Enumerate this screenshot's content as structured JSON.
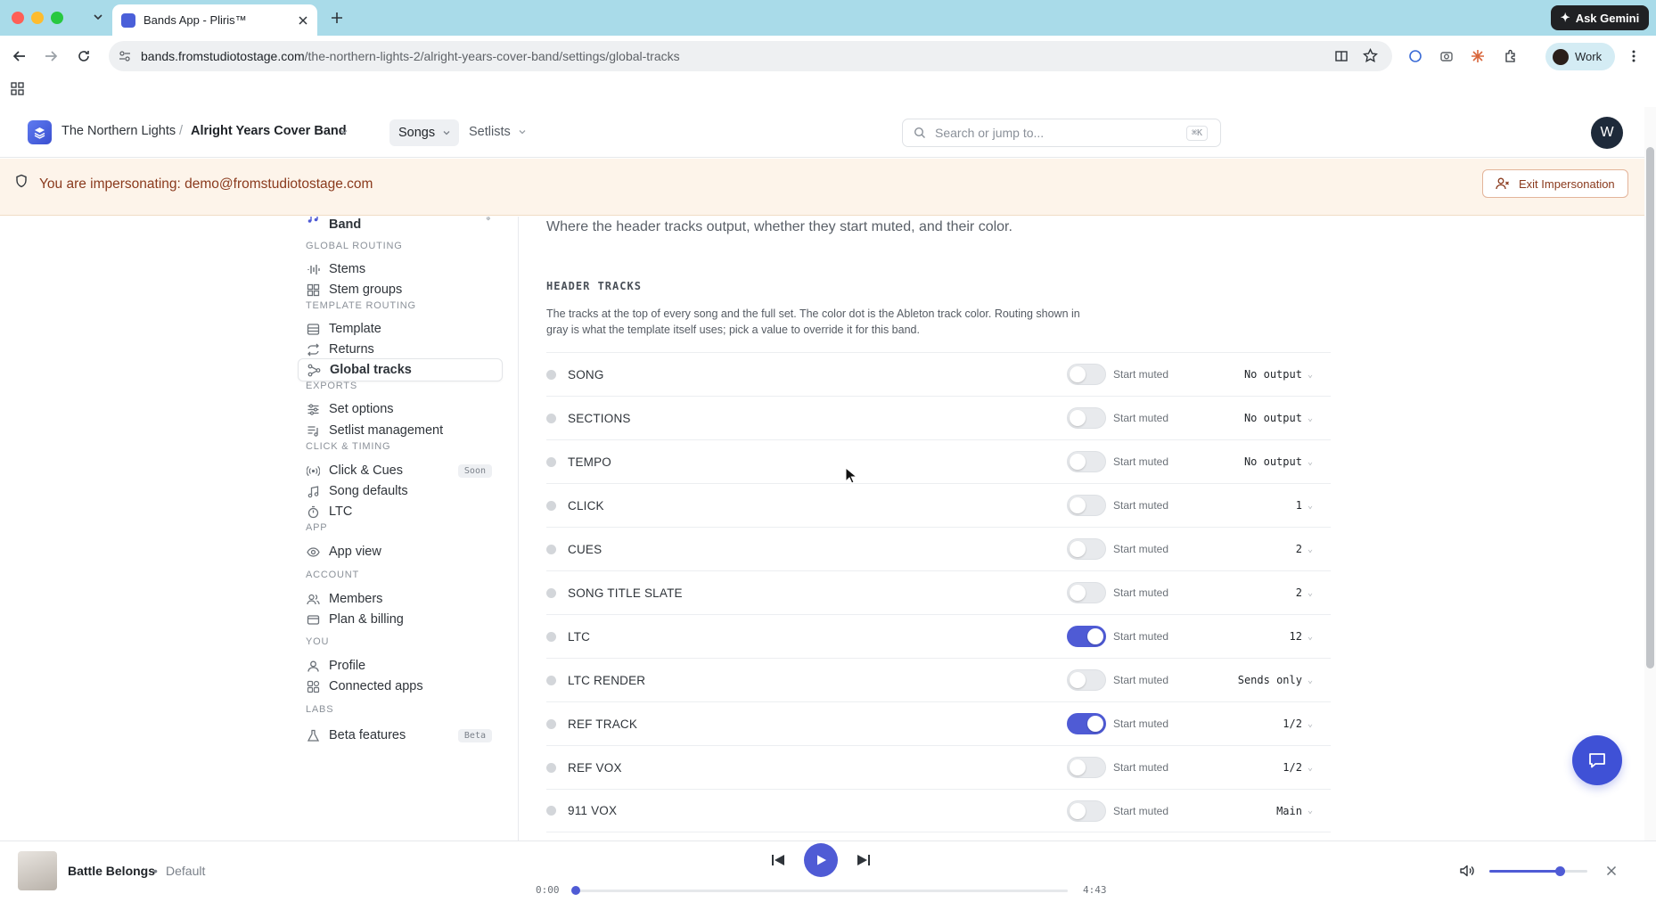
{
  "browser": {
    "tab_title": "Bands App - Pliris™",
    "url_host": "bands.fromstudiotostage.com",
    "url_path": "/the-northern-lights-2/alright-years-cover-band/settings/global-tracks",
    "ask_gemini": "Ask Gemini",
    "profile": "Work"
  },
  "header": {
    "org": "The Northern Lights",
    "separator": "/",
    "band": "Alright Years Cover Band",
    "nav_songs": "Songs",
    "nav_setlists": "Setlists",
    "search_placeholder": "Search or jump to...",
    "search_shortcut": "⌘K",
    "avatar_initial": "W"
  },
  "banner": {
    "text": "You are impersonating: demo@fromstudiotostage.com",
    "exit_label": "Exit Impersonation"
  },
  "sidebar": {
    "band_item": "Alright Years Cover Band",
    "sections": [
      {
        "title": "GLOBAL ROUTING",
        "items": [
          {
            "label": "Stems",
            "icon": "waveform-icon"
          },
          {
            "label": "Stem groups",
            "icon": "grid-icon"
          }
        ]
      },
      {
        "title": "TEMPLATE ROUTING",
        "items": [
          {
            "label": "Template",
            "icon": "layout-icon"
          },
          {
            "label": "Returns",
            "icon": "repeat-icon"
          },
          {
            "label": "Global tracks",
            "icon": "nodes-icon",
            "active": true
          }
        ]
      },
      {
        "title": "EXPORTS",
        "items": [
          {
            "label": "Set options",
            "icon": "sliders-icon"
          },
          {
            "label": "Setlist management",
            "icon": "list-music-icon"
          }
        ]
      },
      {
        "title": "CLICK & TIMING",
        "items": [
          {
            "label": "Click & Cues",
            "icon": "radio-icon",
            "badge": "Soon"
          },
          {
            "label": "Song defaults",
            "icon": "music-note-icon"
          },
          {
            "label": "LTC",
            "icon": "timer-icon"
          }
        ]
      },
      {
        "title": "APP",
        "items": [
          {
            "label": "App view",
            "icon": "eye-icon"
          }
        ]
      },
      {
        "title": "ACCOUNT",
        "items": [
          {
            "label": "Members",
            "icon": "users-icon"
          },
          {
            "label": "Plan & billing",
            "icon": "card-icon"
          }
        ]
      },
      {
        "title": "YOU",
        "items": [
          {
            "label": "Profile",
            "icon": "user-icon"
          },
          {
            "label": "Connected apps",
            "icon": "apps-icon"
          }
        ]
      },
      {
        "title": "LABS",
        "items": [
          {
            "label": "Beta features",
            "icon": "flask-icon",
            "badge": "Beta"
          }
        ]
      }
    ]
  },
  "main": {
    "description": "Where the header tracks output, whether they start muted, and their color.",
    "section_title": "HEADER TRACKS",
    "section_desc": "The tracks at the top of every song and the full set. The color dot is the Ableton track color. Routing shown in gray is what the template itself uses; pick a value to override it for this band.",
    "muted_label": "Start muted",
    "tracks": [
      {
        "name": "SONG",
        "muted": false,
        "output": "No output"
      },
      {
        "name": "SECTIONS",
        "muted": false,
        "output": "No output"
      },
      {
        "name": "TEMPO",
        "muted": false,
        "output": "No output"
      },
      {
        "name": "CLICK",
        "muted": false,
        "output": "1"
      },
      {
        "name": "CUES",
        "muted": false,
        "output": "2"
      },
      {
        "name": "SONG TITLE SLATE",
        "muted": false,
        "output": "2"
      },
      {
        "name": "LTC",
        "muted": true,
        "output": "12"
      },
      {
        "name": "LTC RENDER",
        "muted": false,
        "output": "Sends only"
      },
      {
        "name": "REF TRACK",
        "muted": true,
        "output": "1/2"
      },
      {
        "name": "REF VOX",
        "muted": false,
        "output": "1/2"
      },
      {
        "name": "911 VOX",
        "muted": false,
        "output": "Main"
      }
    ]
  },
  "player": {
    "song_title": "Battle Belongs",
    "separator": "•",
    "version": "Default",
    "time_current": "0:00",
    "time_total": "4:43",
    "progress": 0,
    "volume": 0.72
  },
  "colors": {
    "accent": "#4f5bd5",
    "banner_bg": "#fdf4ea",
    "banner_text": "#8a3a1d"
  }
}
